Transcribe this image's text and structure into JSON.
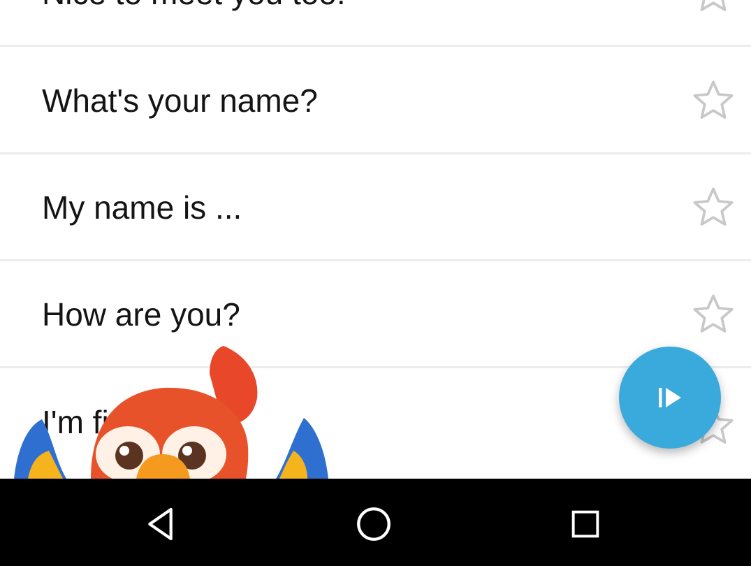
{
  "phrases": [
    {
      "text": "Nice to meet you too.",
      "icon": "star-outline-icon"
    },
    {
      "text": "What's your name?",
      "icon": "star-outline-icon"
    },
    {
      "text": "My name is ...",
      "icon": "star-outline-icon"
    },
    {
      "text": "How are you?",
      "icon": "star-outline-icon"
    },
    {
      "text": "I'm fine",
      "icon": "star-outline-icon"
    }
  ],
  "fab": {
    "icon": "play-next-icon",
    "color": "#3aa9dc"
  },
  "mascot": {
    "icon": "parrot-mascot"
  },
  "navbar": {
    "back_icon": "back-triangle-icon",
    "home_icon": "home-circle-icon",
    "recents_icon": "recents-square-icon"
  },
  "colors": {
    "accent": "#3aa9dc",
    "text": "#141414",
    "star": "#c8c8c8",
    "divider": "#ececec",
    "navbar": "#000000"
  }
}
